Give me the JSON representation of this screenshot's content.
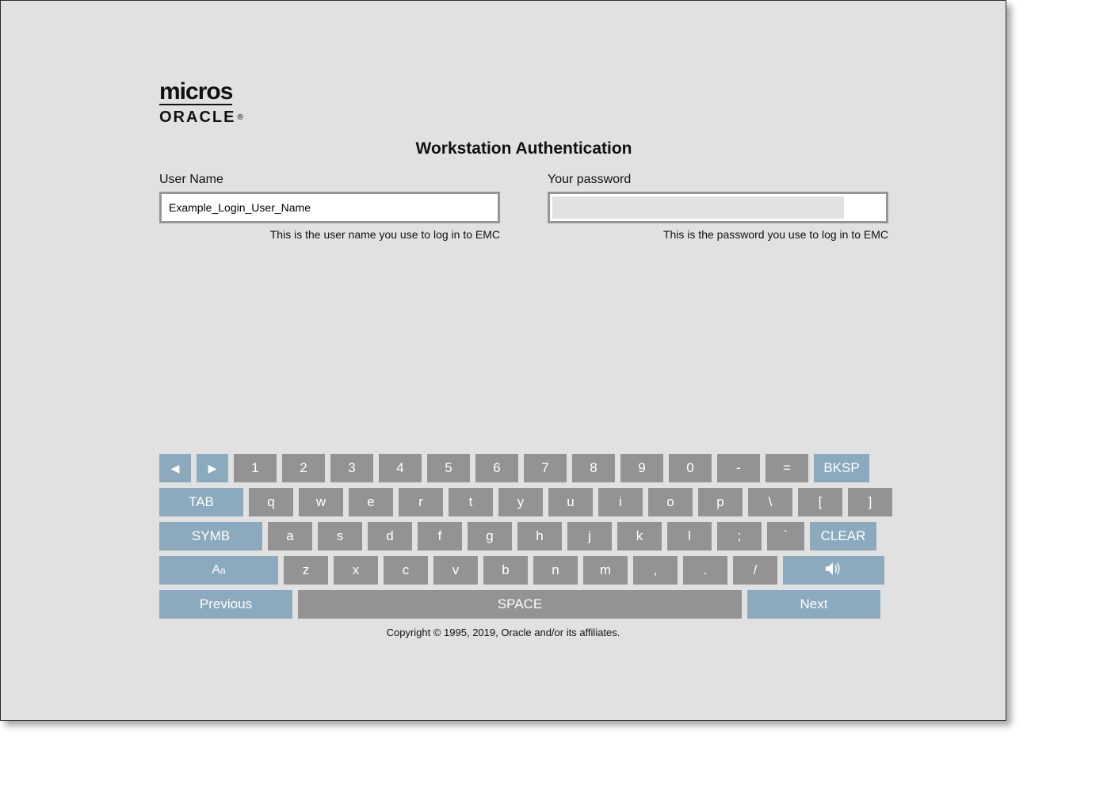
{
  "logo": {
    "top": "micros",
    "bottom": "ORACLE"
  },
  "title": "Workstation Authentication",
  "username": {
    "label": "User Name",
    "value": "Example_Login_User_Name",
    "help": "This is the user name you use to log in to EMC"
  },
  "password": {
    "label": "Your password",
    "value": "",
    "help": "This is the password you use to log in to EMC"
  },
  "keyboard": {
    "bksp": "BKSP",
    "tab": "TAB",
    "symb": "SYMB",
    "clear": "CLEAR",
    "space": "SPACE",
    "previous": "Previous",
    "next": "Next",
    "row1": [
      "1",
      "2",
      "3",
      "4",
      "5",
      "6",
      "7",
      "8",
      "9",
      "0",
      "-",
      "="
    ],
    "row2": [
      "q",
      "w",
      "e",
      "r",
      "t",
      "y",
      "u",
      "i",
      "o",
      "p",
      "\\",
      "[",
      "]"
    ],
    "row3": [
      "a",
      "s",
      "d",
      "f",
      "g",
      "h",
      "j",
      "k",
      "l",
      ";",
      "`"
    ],
    "row4": [
      "z",
      "x",
      "c",
      "v",
      "b",
      "n",
      "m",
      ",",
      ".",
      "/"
    ]
  },
  "copyright": "Copyright © 1995, 2019, Oracle and/or its affiliates."
}
